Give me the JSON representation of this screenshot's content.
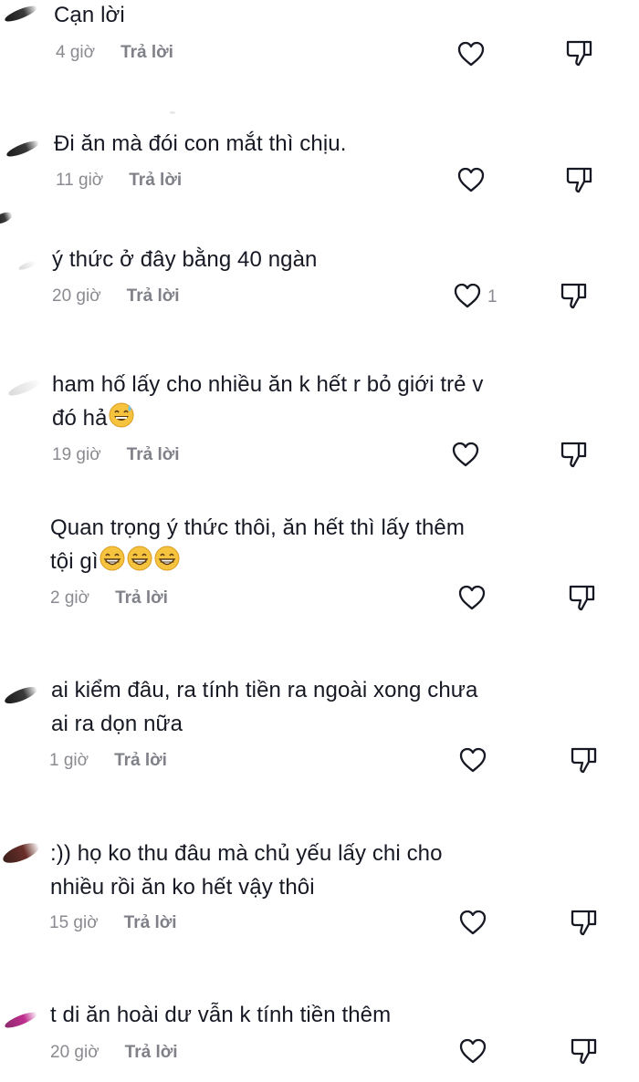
{
  "comments": [
    {
      "text": "Cạn lời",
      "time": "4 giờ",
      "reply": "Trả lời",
      "likes": ""
    },
    {
      "text": "Đi ăn mà đói con mắt thì chịu.",
      "time": "11 giờ",
      "reply": "Trả lời",
      "likes": ""
    },
    {
      "text": "ý thức ở đây bằng 40 ngàn",
      "time": "20 giờ",
      "reply": "Trả lời",
      "likes": "1"
    },
    {
      "text": "ham hố lấy cho nhiều ăn k hết r bỏ giới trẻ v\nđó hả",
      "time": "19 giờ",
      "reply": "Trả lời",
      "likes": "",
      "emoji": [
        "sweat-smile-emoji"
      ]
    },
    {
      "text": "Quan trọng ý thức thôi, ăn hết thì lấy thêm\ntội gì",
      "time": "2 giờ",
      "reply": "Trả lời",
      "likes": "",
      "emoji": [
        "grin-emoji",
        "grin-emoji",
        "grin-emoji"
      ]
    },
    {
      "text": "ai kiểm đâu, ra tính tiền ra ngoài xong chưa\nai ra dọn nữa",
      "time": "1 giờ",
      "reply": "Trả lời",
      "likes": ""
    },
    {
      "text": ":)) họ ko thu đâu mà chủ yếu lấy chi cho\nnhiều rồi ăn ko hết vậy thôi",
      "time": "15 giờ",
      "reply": "Trả lời",
      "likes": ""
    },
    {
      "text": "t di ăn hoài dư vẫn k tính tiền thêm",
      "time": "20 giờ",
      "reply": "Trả lời",
      "likes": ""
    }
  ],
  "icons": {
    "like": "heart-outline-icon",
    "dislike": "thumbs-down-outline-icon"
  },
  "colors": {
    "text": "#161823",
    "meta": "#8a8b91",
    "icon": "#161823"
  }
}
